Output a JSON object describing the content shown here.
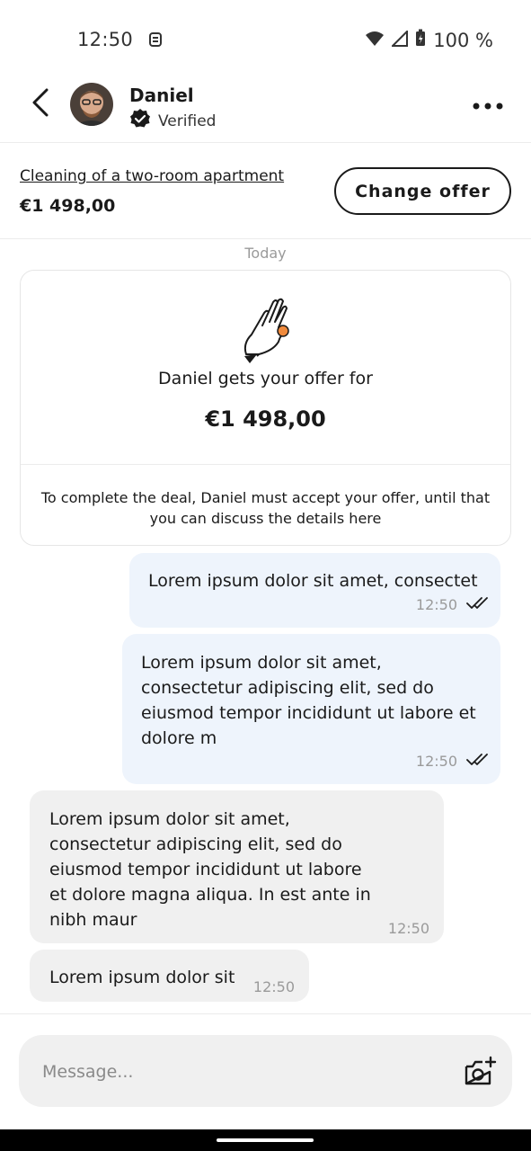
{
  "status_bar": {
    "time": "12:50",
    "battery": "100 %"
  },
  "header": {
    "contact_name": "Daniel",
    "verified_label": "Verified"
  },
  "offer_strip": {
    "title": "Cleaning of a two-room apartment",
    "price": "€1 498,00",
    "change_button": "Change offer"
  },
  "chat": {
    "day_label": "Today",
    "offer_card": {
      "text": "Daniel gets your offer for",
      "price": "€1 498,00",
      "note": "To complete the deal, Daniel must accept your offer, until that you can discuss the details here"
    },
    "messages": [
      {
        "direction": "out",
        "text": "Lorem ipsum dolor sit amet, consectet",
        "time": "12:50"
      },
      {
        "direction": "out",
        "text": "Lorem ipsum dolor sit amet,\nconsectetur adipiscing elit, sed do\neiusmod tempor incididunt ut labore et\ndolore m",
        "time": "12:50"
      },
      {
        "direction": "in",
        "text": "Lorem ipsum dolor sit amet,\nconsectetur adipiscing elit, sed do\neiusmod tempor incididunt ut labore\net dolore magna aliqua. In est ante in\nnibh maur",
        "time": "12:50"
      },
      {
        "direction": "in",
        "text": "Lorem ipsum dolor sit",
        "time": "12:50"
      }
    ]
  },
  "composer": {
    "placeholder": "Message..."
  },
  "icons": [
    "back-arrow-icon",
    "more-dots-icon",
    "verified-badge-icon",
    "hand-coin-icon",
    "double-check-icon",
    "camera-add-icon",
    "wifi-icon",
    "signal-icon",
    "battery-icon",
    "sim-icon"
  ],
  "colors": {
    "outgoing_bubble": "#eef4fc",
    "incoming_bubble": "#f0f0f0",
    "accent_coin": "#f08a3c"
  }
}
